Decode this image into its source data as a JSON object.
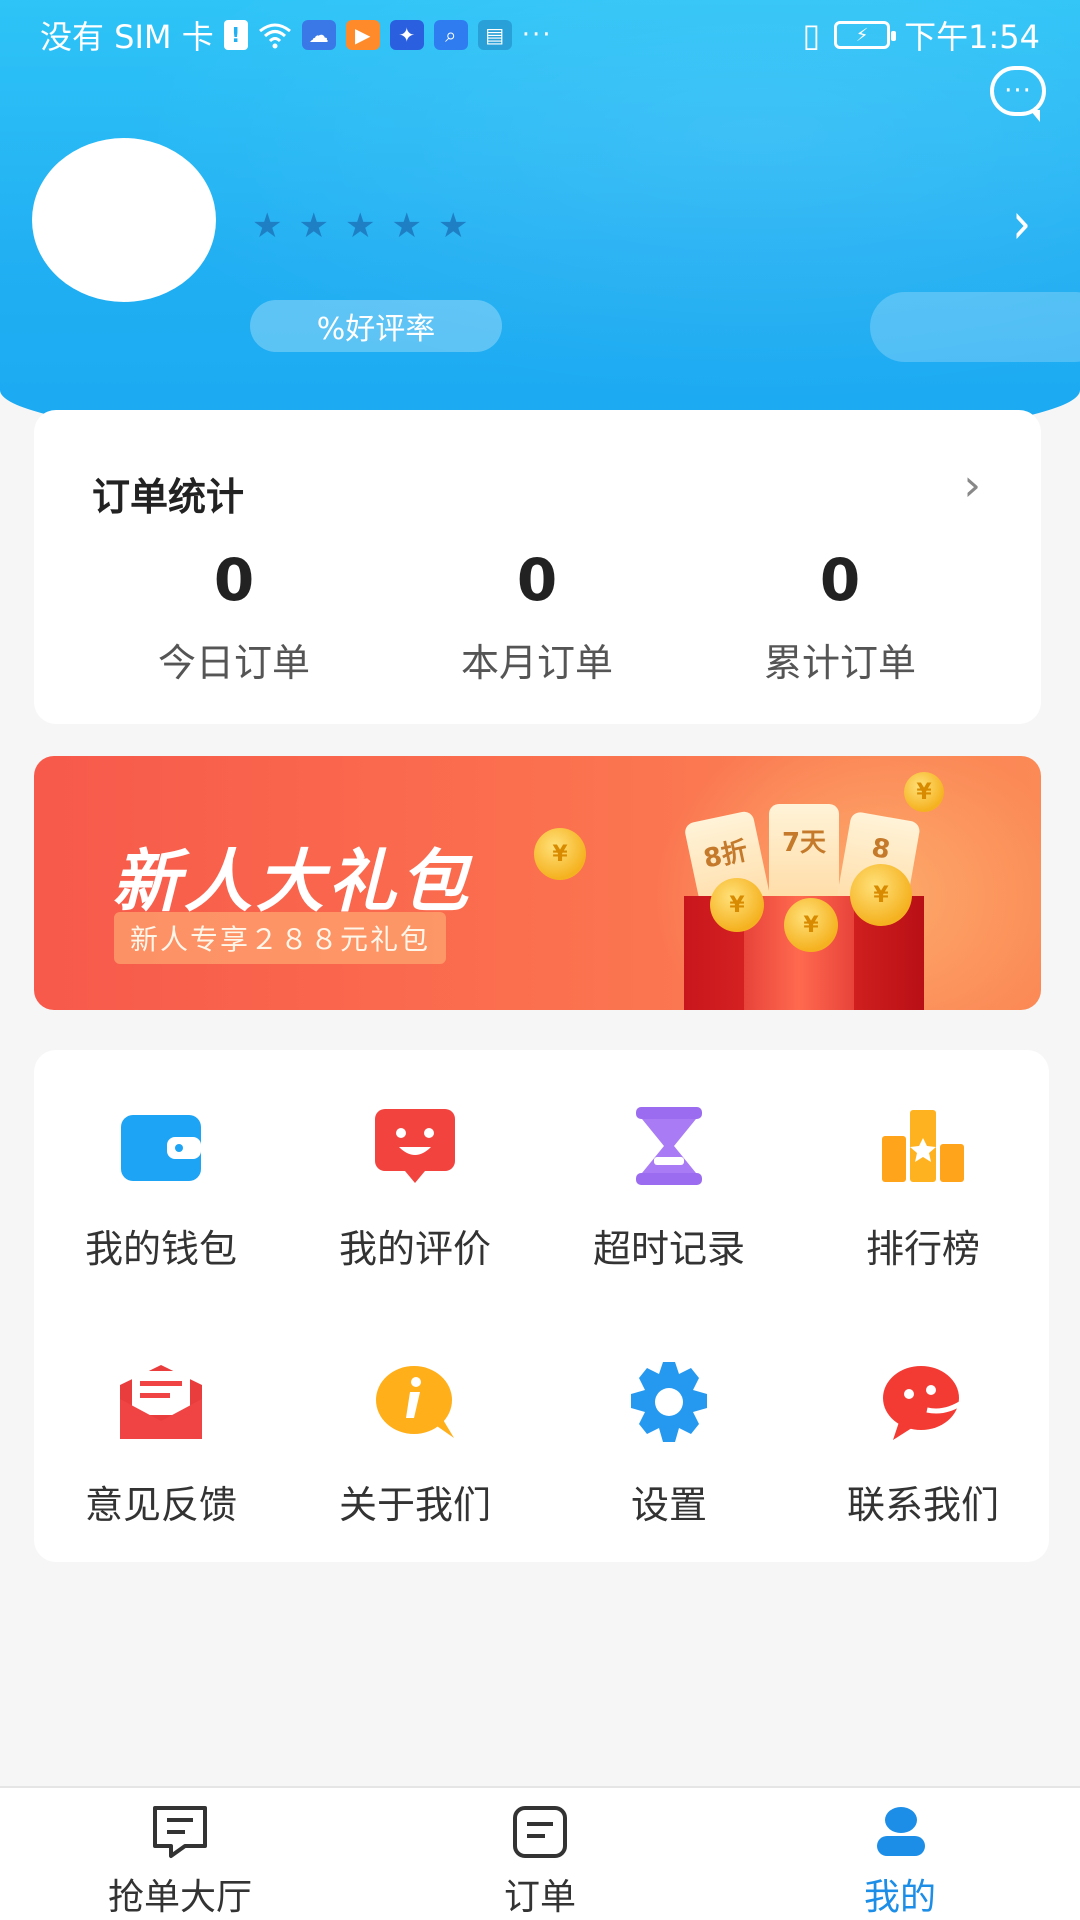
{
  "status_bar": {
    "carrier": "没有 SIM 卡",
    "more": "···",
    "time": "下午1:54",
    "vibrate": "▯",
    "battery_symbol": "⚡"
  },
  "header": {
    "message_icon_dots": "···",
    "stars": [
      "★",
      "★",
      "★",
      "★",
      "★"
    ],
    "arrow": "›",
    "good_rate_label": "%好评率"
  },
  "order_stats": {
    "title": "订单统计",
    "arrow": "›",
    "items": [
      {
        "value": "0",
        "label": "今日订单"
      },
      {
        "value": "0",
        "label": "本月订单"
      },
      {
        "value": "0",
        "label": "累计订单"
      }
    ]
  },
  "banner": {
    "title": "新人大礼包",
    "subtitle": "新人专享２８８元礼包",
    "coin_symbol": "¥",
    "tickets": [
      "8折",
      "7天",
      "8"
    ]
  },
  "menu": {
    "items": [
      {
        "label": "我的钱包",
        "icon": "wallet-icon",
        "color": "#1ea4f5"
      },
      {
        "label": "我的评价",
        "icon": "review-icon",
        "color": "#f2433e"
      },
      {
        "label": "超时记录",
        "icon": "hourglass-icon",
        "color": "#9b6cf0"
      },
      {
        "label": "排行榜",
        "icon": "ranking-icon",
        "color": "#ffa41b"
      },
      {
        "label": "意见反馈",
        "icon": "feedback-icon",
        "color": "#f04444"
      },
      {
        "label": "关于我们",
        "icon": "info-icon",
        "color": "#ffaf1a"
      },
      {
        "label": "设置",
        "icon": "settings-icon",
        "color": "#2599f0"
      },
      {
        "label": "联系我们",
        "icon": "contact-icon",
        "color": "#f33b34"
      }
    ]
  },
  "tabs": [
    {
      "label": "抢单大厅",
      "icon": "order-hall-icon",
      "active": false
    },
    {
      "label": "订单",
      "icon": "orders-icon",
      "active": false
    },
    {
      "label": "我的",
      "icon": "profile-icon",
      "active": true
    }
  ],
  "colors": {
    "header": "#22b0f3",
    "accent": "#1c8ee8",
    "banner": "#f7594b"
  }
}
